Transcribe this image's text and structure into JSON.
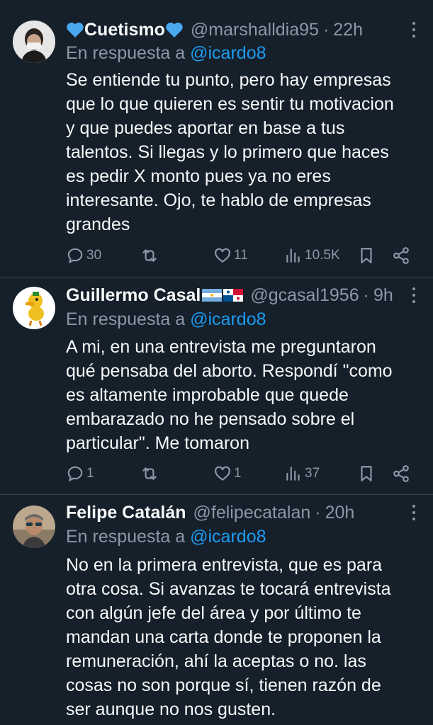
{
  "tweets": [
    {
      "name_pre_icon": "blue-heart-icon",
      "name": "Cuetismo",
      "name_post_icon": "blue-heart-icon",
      "handle": "@marshalldia95",
      "time": "22h",
      "reply_label": "En respuesta a",
      "reply_to": "@icardo8",
      "lines": [
        "Se entiende tu punto, pero hay empresas",
        "que lo que quieren es sentir tu motivacion",
        "y que puedes aportar en base a tus",
        "talentos. Si llegas y lo primero que haces",
        "es pedir X monto pues ya no eres",
        "interesante. Ojo, te hablo de empresas",
        "grandes"
      ],
      "replies": "30",
      "retweets": "",
      "likes": "11",
      "views": "10.5K"
    },
    {
      "name": "Guillermo Casal",
      "name_flags": [
        "argentina-flag-icon",
        "panama-flag-icon"
      ],
      "handle": "@gcasal1956",
      "time": "9h",
      "reply_label": "En respuesta a",
      "reply_to": "@icardo8",
      "lines": [
        "A mi, en una entrevista me preguntaron",
        "qué pensaba del aborto. Respondí \"como",
        "es altamente improbable que quede",
        "embarazado no he pensado sobre el",
        "particular\". Me tomaron"
      ],
      "replies": "1",
      "retweets": "",
      "likes": "1",
      "views": "37"
    },
    {
      "name": "Felipe Catalán",
      "handle": "@felipecatalan",
      "time": "20h",
      "reply_label": "En respuesta a",
      "reply_to": "@icardo8",
      "lines": [
        "No en la primera entrevista, que es para",
        "otra cosa. Si avanzas te tocará entrevista",
        "con algún jefe del área y por último te",
        "mandan una carta donde te proponen la",
        "remuneración, ahí la aceptas o no. las",
        "cosas no son porque sí, tienen razón de",
        "ser aunque no nos gusten."
      ]
    }
  ],
  "colors": {
    "background": "#15202b",
    "text": "#f7f9f9",
    "secondary": "#8b98a5",
    "link": "#1d9bf0",
    "divider": "#38444d"
  }
}
